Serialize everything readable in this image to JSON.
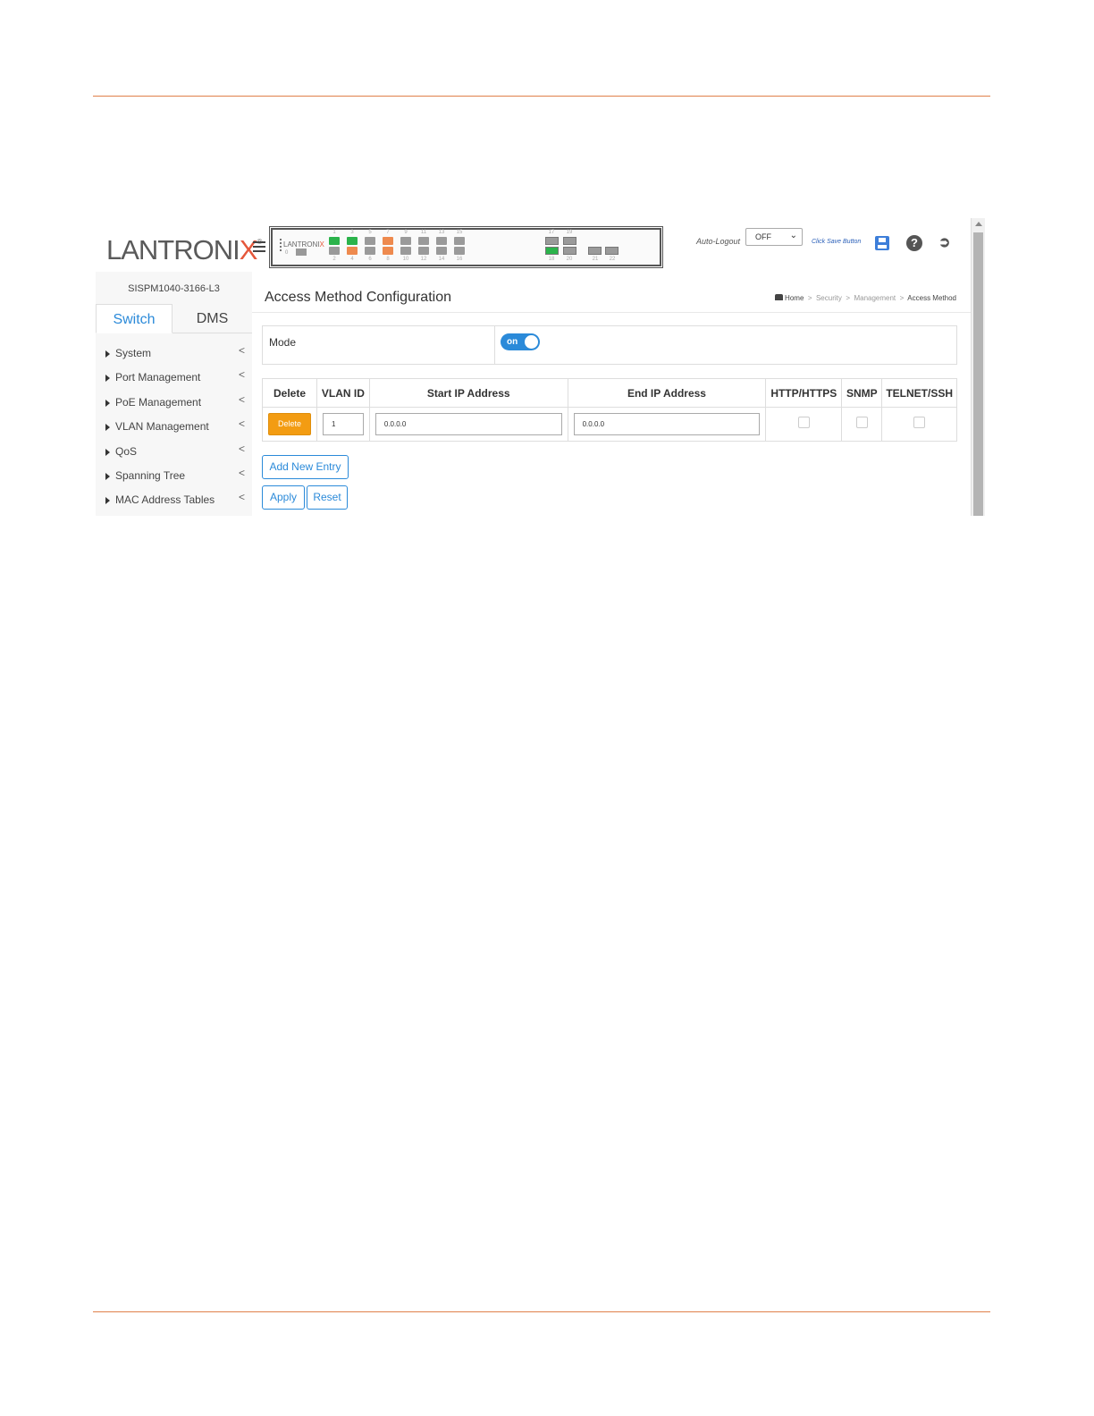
{
  "header": {
    "logo_main": "LANTRONI",
    "logo_x": "X",
    "logo_reg": "®",
    "panel_logo_main": "LANTRONI",
    "panel_logo_x": "X",
    "panel_zero": "0",
    "ports_top": [
      "1",
      "3",
      "5",
      "7",
      "9",
      "11",
      "13",
      "15"
    ],
    "ports_bottom": [
      "2",
      "4",
      "6",
      "8",
      "10",
      "12",
      "14",
      "16"
    ],
    "sfp_top": [
      "17",
      "19"
    ],
    "sfp_bottom": [
      "18",
      "20",
      "21",
      "22"
    ],
    "auto_logout_label": "Auto-Logout",
    "auto_logout_value": "OFF",
    "click_save": "Click Save Button"
  },
  "sidebar": {
    "device_name": "SISPM1040-3166-L3",
    "tabs": [
      "Switch",
      "DMS"
    ],
    "active_tab": "Switch",
    "items": [
      "System",
      "Port Management",
      "PoE Management",
      "VLAN Management",
      "QoS",
      "Spanning Tree",
      "MAC Address Tables"
    ],
    "chevron": "<"
  },
  "content": {
    "title": "Access Method Configuration",
    "breadcrumb": {
      "home": "Home",
      "sep": ">",
      "items": [
        "Security",
        "Management"
      ],
      "current": "Access Method"
    },
    "mode": {
      "label": "Mode",
      "toggle_label": "on",
      "enabled": true
    },
    "table": {
      "headers": [
        "Delete",
        "VLAN ID",
        "Start IP Address",
        "End IP Address",
        "HTTP/HTTPS",
        "SNMP",
        "TELNET/SSH"
      ],
      "rows": [
        {
          "delete_label": "Delete",
          "vlan_id": "1",
          "start_ip": "0.0.0.0",
          "end_ip": "0.0.0.0",
          "http": false,
          "snmp": false,
          "telnet": false
        }
      ]
    },
    "buttons": {
      "add": "Add New Entry",
      "apply": "Apply",
      "reset": "Reset"
    }
  },
  "colors": {
    "accent": "#2b8ad9",
    "delete": "#f39c12",
    "page_rule": "#e0804a",
    "logo_x": "#e5573b"
  }
}
